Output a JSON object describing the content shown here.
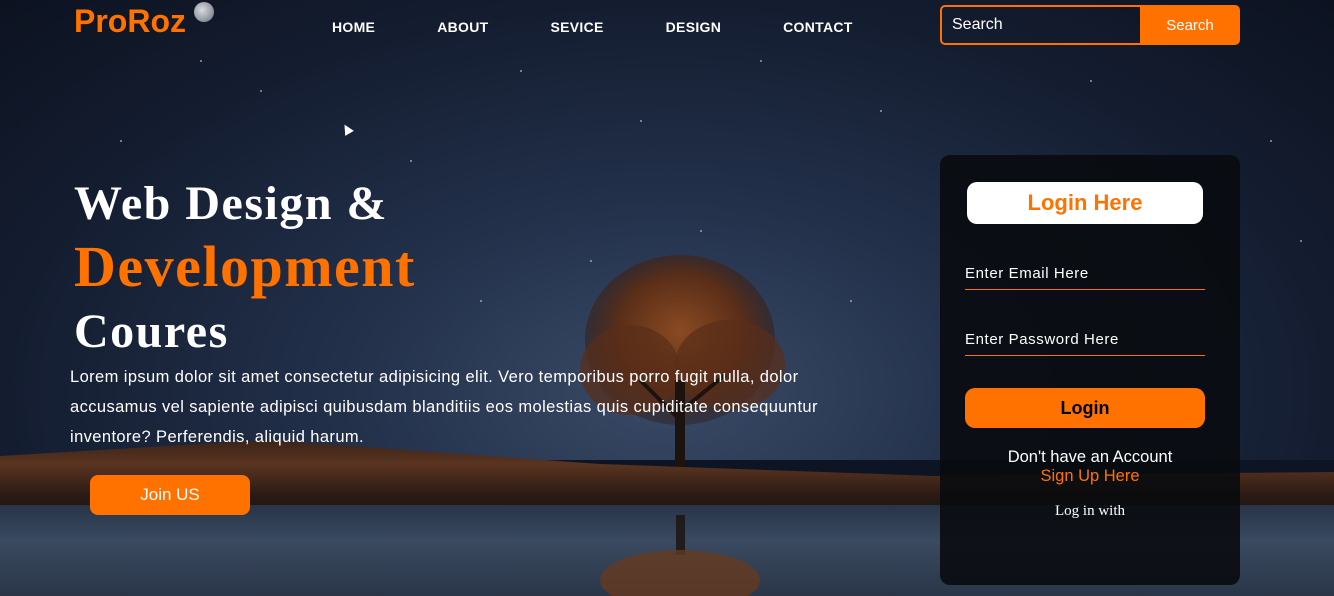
{
  "header": {
    "logo": "ProRoz",
    "nav": [
      "HOME",
      "ABOUT",
      "SEVICE",
      "DESIGN",
      "CONTACT"
    ],
    "search_placeholder": "Search",
    "search_button": "Search"
  },
  "hero": {
    "title_line1": "Web Design &",
    "title_line2": "Development",
    "title_line3": "Coures",
    "text": "Lorem ipsum dolor sit amet consectetur adipisicing elit. Vero temporibus porro fugit nulla, dolor accusamus vel sapiente adipisci quibusdam blanditiis eos molestias quis cupiditate consequuntur inventore? Perferendis, aliquid harum.",
    "join_button": "Join US"
  },
  "login": {
    "title": "Login Here",
    "email_placeholder": "Enter Email Here",
    "password_placeholder": "Enter Password Here",
    "button": "Login",
    "no_account": "Don't have an Account",
    "signup": "Sign Up Here",
    "login_with": "Log in with"
  },
  "colors": {
    "accent": "#ff7200",
    "card_bg": "#080a0e"
  }
}
